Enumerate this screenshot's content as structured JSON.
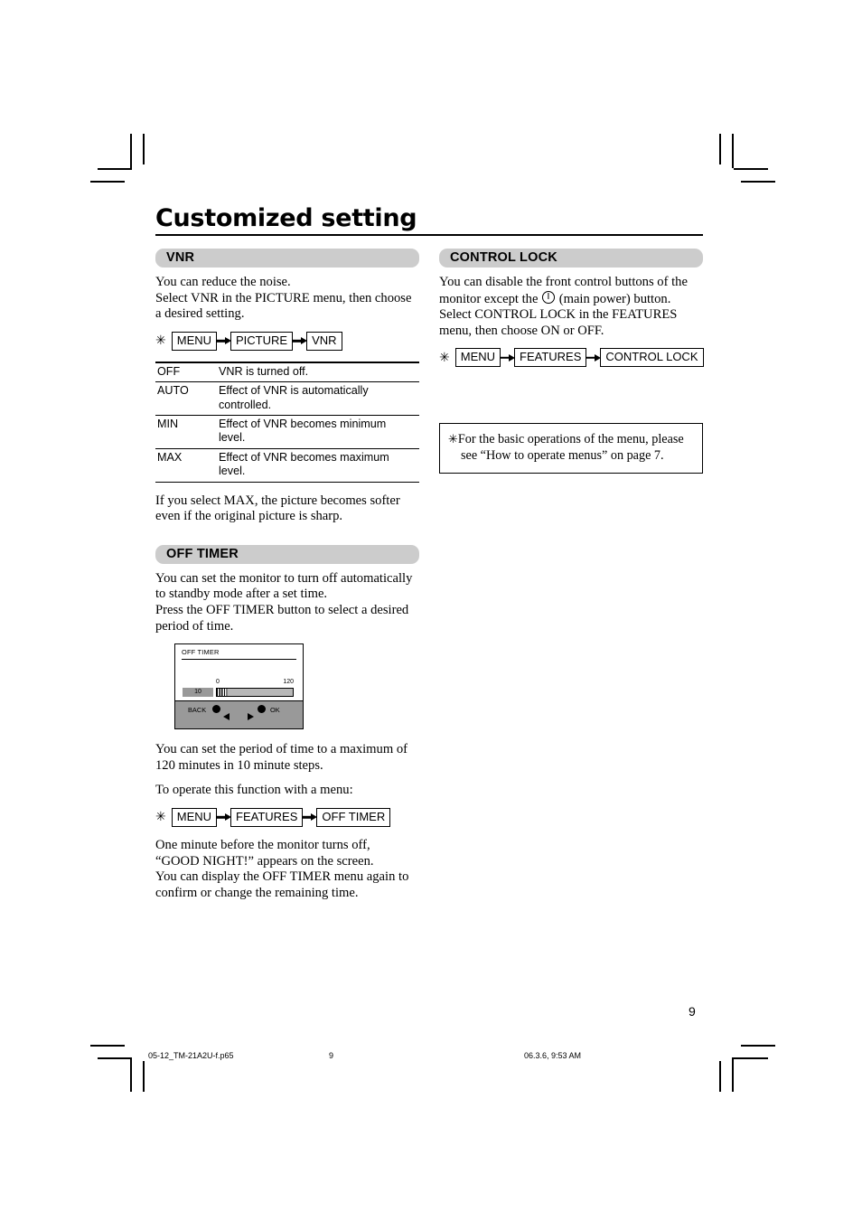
{
  "document": {
    "title": "Customized setting",
    "page_number": "9"
  },
  "sections": {
    "vnr": {
      "heading": "VNR",
      "intro_line1": "You can reduce the noise.",
      "intro_line2": "Select VNR in the PICTURE menu, then choose",
      "intro_line3": "a desired setting.",
      "flow": {
        "asterisk": "✳",
        "steps": [
          "MENU",
          "PICTURE",
          "VNR"
        ]
      },
      "table": {
        "rows": [
          {
            "term": "OFF",
            "desc": "VNR is turned off."
          },
          {
            "term": "AUTO",
            "desc": "Effect of VNR is automatically controlled."
          },
          {
            "term": "MIN",
            "desc": "Effect of VNR becomes minimum level."
          },
          {
            "term": "MAX",
            "desc": "Effect of VNR becomes maximum level."
          }
        ]
      },
      "outro_line1": "If you select MAX, the picture becomes softer",
      "outro_line2": "even if the original picture is sharp."
    },
    "off_timer": {
      "heading": "OFF TIMER",
      "para1_line1": "You can set the monitor to turn off automatically",
      "para1_line2": "to standby mode after a set time.",
      "para1_line3": "Press the OFF TIMER button to select a desired",
      "para1_line4": "period of time.",
      "osd": {
        "title": "OFF TIMER",
        "value": "10",
        "scale_min": "0",
        "scale_max": "120",
        "back_label": "BACK",
        "ok_label": "OK"
      },
      "para2_line1": "You can set the period of time to a maximum of",
      "para2_line2": "120 minutes in 10 minute steps.",
      "para3": "To operate this function with a menu:",
      "flow": {
        "asterisk": "✳",
        "steps": [
          "MENU",
          "FEATURES",
          "OFF TIMER"
        ]
      },
      "para4_line1": "One minute before the monitor turns off,",
      "para4_line2": "“GOOD NIGHT!” appears on the screen.",
      "para4_line3": "You can display the OFF TIMER menu again to",
      "para4_line4": "confirm or change the remaining time."
    },
    "control_lock": {
      "heading": "CONTROL LOCK",
      "para_line1_a": "You can disable the front control buttons of the",
      "para_line2_a": "monitor except the ",
      "para_line2_b": " (main power) button.",
      "para_line3": "Select CONTROL LOCK in the FEATURES",
      "para_line4": "menu, then choose ON or OFF.",
      "flow": {
        "asterisk": "✳",
        "steps": [
          "MENU",
          "FEATURES",
          "CONTROL LOCK"
        ]
      },
      "note": {
        "asterisk": "✳",
        "line1": "For the basic operations of the menu, please",
        "line2": "see “How to operate menus” on page 7."
      }
    }
  },
  "footer": {
    "filename": "05-12_TM-21A2U-f.p65",
    "page": "9",
    "timestamp": "06.3.6, 9:53 AM"
  },
  "colors": {
    "section_header_bg": "#cccccc",
    "osd_gray": "#999999",
    "osd_bar_track": "#b8b8b8",
    "ink": "#000000",
    "paper": "#ffffff"
  }
}
